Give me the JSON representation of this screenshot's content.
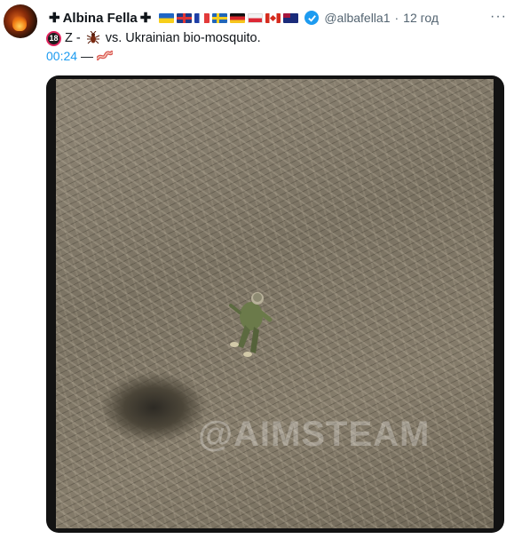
{
  "tweet": {
    "author": {
      "prefix_symbol": "✚",
      "display_name": "Albina Fella",
      "suffix_symbol": "✚",
      "flags": [
        "ukraine-flag",
        "uk-flag",
        "france-flag",
        "sweden-flag",
        "germany-flag",
        "poland-flag",
        "canada-flag",
        "australia-flag"
      ],
      "verified_icon": "verified-badge-icon",
      "handle": "@albafella1",
      "separator": "·",
      "time": "12 год"
    },
    "more_label": "···",
    "text": {
      "badge": "18",
      "prefix": "Z -",
      "suffix": "vs. Ukrainian bio-mosquito."
    },
    "video": {
      "duration": "00:24",
      "dash": "—",
      "watermark": "@AIMSTEAM"
    }
  },
  "colors": {
    "accent": "#1d9bf0",
    "text": "#0f1419",
    "muted": "#536471"
  }
}
